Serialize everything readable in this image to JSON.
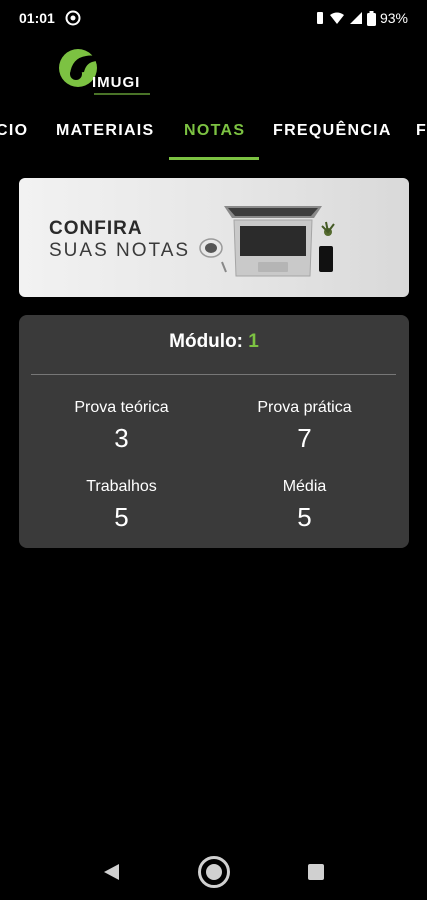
{
  "status": {
    "time": "01:01",
    "battery": "93%"
  },
  "tabs": [
    {
      "label": "CIO"
    },
    {
      "label": "MATERIAIS"
    },
    {
      "label": "NOTAS"
    },
    {
      "label": "FREQUÊNCIA"
    },
    {
      "label": "F"
    }
  ],
  "banner": {
    "title": "CONFIRA",
    "subtitle": "SUAS NOTAS"
  },
  "card": {
    "module_label": "Módulo:",
    "module_value": "1",
    "grades": [
      {
        "label": "Prova teórica",
        "value": "3"
      },
      {
        "label": "Prova prática",
        "value": "7"
      },
      {
        "label": "Trabalhos",
        "value": "5"
      },
      {
        "label": "Média",
        "value": "5"
      }
    ]
  },
  "colors": {
    "accent": "#7cc242",
    "card_bg": "#3a3a3a",
    "background": "#000000"
  },
  "logo": {
    "text": "IMUGI"
  }
}
